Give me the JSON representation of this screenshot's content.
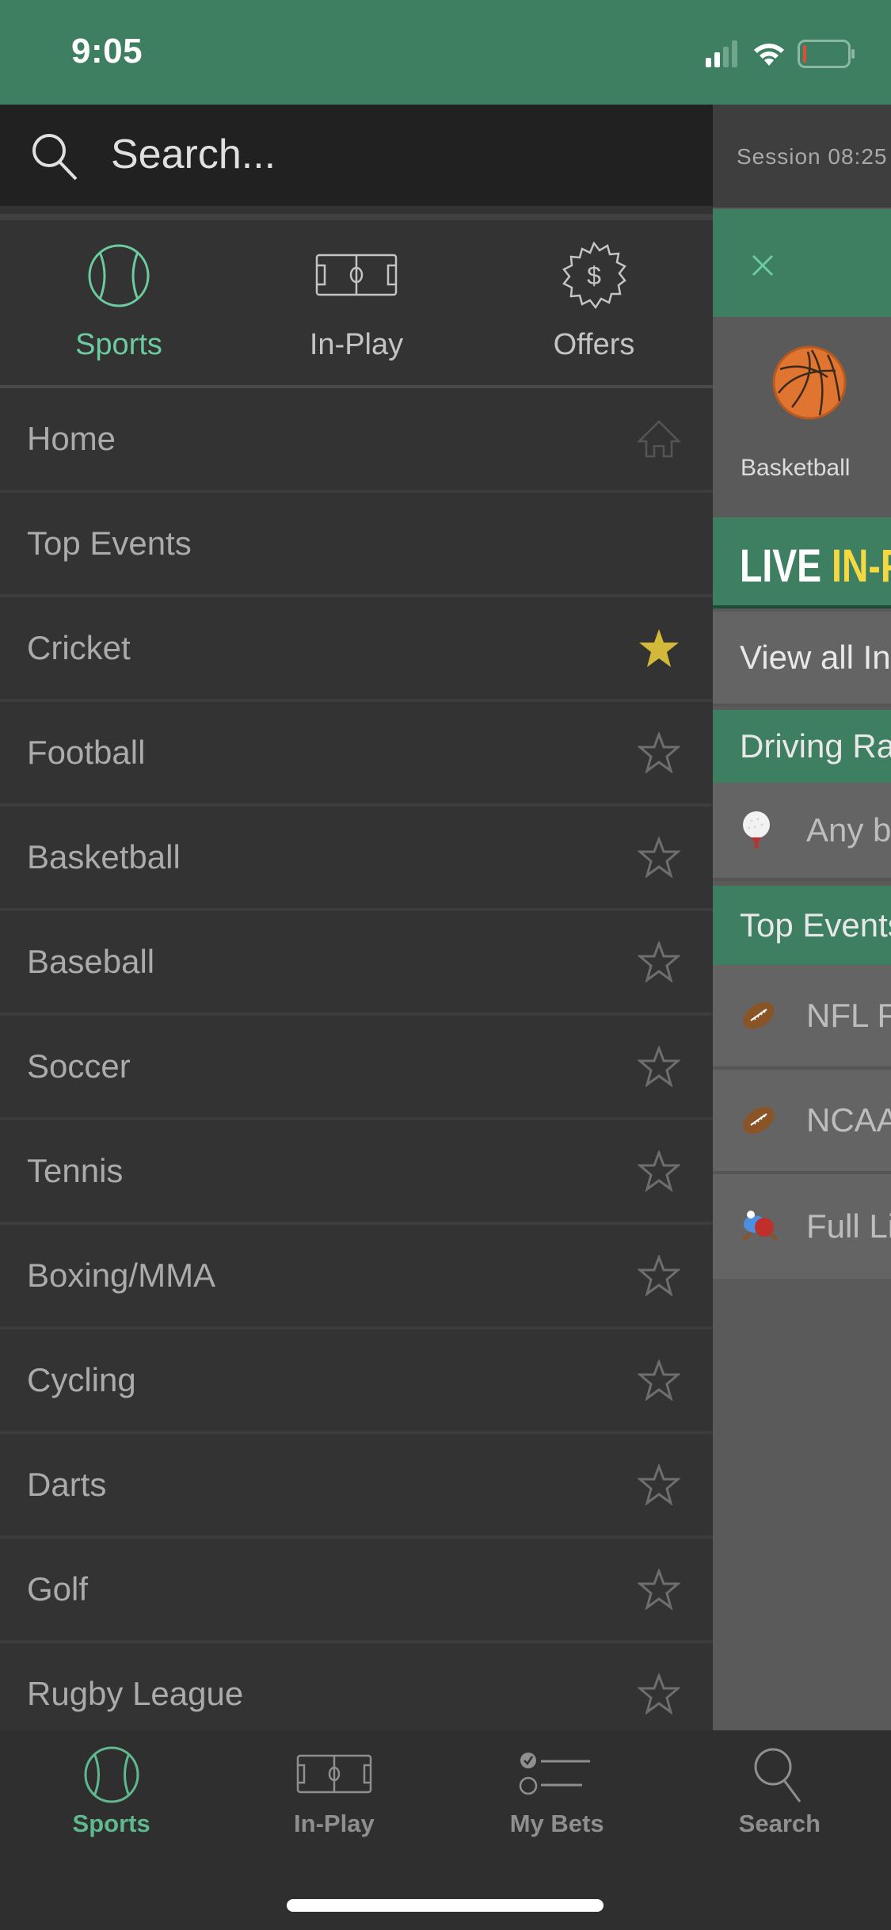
{
  "status_bar": {
    "time": "9:05",
    "icons": [
      "cellular-signal-icon",
      "wifi-icon",
      "battery-low-icon"
    ]
  },
  "colors": {
    "brand_green": "#3d7f60",
    "accent_mint": "#6dcba0",
    "favorite_gold": "#d4b83a",
    "live_yellow": "#f6d842"
  },
  "drawer": {
    "search": {
      "placeholder": "Search...",
      "value": ""
    },
    "tabs": [
      {
        "label": "Sports",
        "icon": "ball-icon",
        "active": true
      },
      {
        "label": "In-Play",
        "icon": "pitch-icon",
        "active": false
      },
      {
        "label": "Offers",
        "icon": "offer-badge-icon",
        "active": false
      }
    ],
    "items": [
      {
        "label": "Home",
        "trail_icon": "home-icon",
        "favorite": false
      },
      {
        "label": "Top Events",
        "trail_icon": "",
        "favorite": false
      },
      {
        "label": "Cricket",
        "trail_icon": "star-filled-icon",
        "favorite": true
      },
      {
        "label": "Football",
        "trail_icon": "star-outline-icon",
        "favorite": false
      },
      {
        "label": "Basketball",
        "trail_icon": "star-outline-icon",
        "favorite": false
      },
      {
        "label": "Baseball",
        "trail_icon": "star-outline-icon",
        "favorite": false
      },
      {
        "label": "Soccer",
        "trail_icon": "star-outline-icon",
        "favorite": false
      },
      {
        "label": "Tennis",
        "trail_icon": "star-outline-icon",
        "favorite": false
      },
      {
        "label": "Boxing/MMA",
        "trail_icon": "star-outline-icon",
        "favorite": false
      },
      {
        "label": "Cycling",
        "trail_icon": "star-outline-icon",
        "favorite": false
      },
      {
        "label": "Darts",
        "trail_icon": "star-outline-icon",
        "favorite": false
      },
      {
        "label": "Golf",
        "trail_icon": "star-outline-icon",
        "favorite": false
      },
      {
        "label": "Rugby League",
        "trail_icon": "star-outline-icon",
        "favorite": false
      }
    ]
  },
  "main": {
    "session_text": "Session 08:25",
    "sport_tile": {
      "label": "Basketball",
      "icon": "basketball-icon"
    },
    "live_banner": {
      "white": "LIVE ",
      "yellow": "IN-PLAY"
    },
    "view_all": "View all In-Play",
    "driving_range_header": "Driving Range",
    "driving_range_item": {
      "text": "Any ball",
      "icon": "golf-ball-icon"
    },
    "top_events_header": "Top Events",
    "top_events": [
      {
        "text": "NFL Futures",
        "icon": "american-football-icon"
      },
      {
        "text": "NCAAF",
        "icon": "american-football-icon"
      },
      {
        "text": "Full List",
        "icon": "table-tennis-icon"
      }
    ]
  },
  "tab_bar": {
    "tabs": [
      {
        "label": "Sports",
        "icon": "ball-icon",
        "active": true
      },
      {
        "label": "In-Play",
        "icon": "pitch-icon",
        "active": false
      },
      {
        "label": "My Bets",
        "icon": "bet-list-icon",
        "active": false
      },
      {
        "label": "Search",
        "icon": "search-icon",
        "active": false
      }
    ]
  }
}
